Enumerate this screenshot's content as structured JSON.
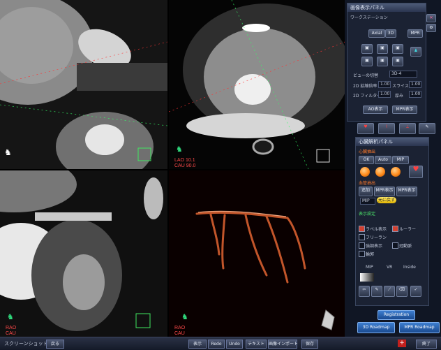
{
  "views": {
    "axial": {
      "orient_label": "LAO",
      "orient_value": "10.1",
      "cau_label": "CAU",
      "cau_value": "90.0"
    },
    "bottom_left": {
      "rao_label": "RAO",
      "cau_label": "CAU"
    },
    "vr": {
      "rao_label": "RAO",
      "cau_label": "CAU"
    }
  },
  "panel_top": {
    "title": "画像表示パネル",
    "sub_title": "ワークステーション",
    "tabs": [
      "Axial",
      "3D",
      "MPR"
    ],
    "rows": [
      {
        "label": "ビューの切替",
        "value": "3D-4"
      },
      {
        "label": "2D 拡縮倍率",
        "value": "1.00",
        "label2": "スライス",
        "value2": "1.00"
      },
      {
        "label": "2D フィルター",
        "value": "1.00",
        "label2": "厚み",
        "value2": "1.00"
      }
    ],
    "button_left": "AO表示",
    "button_right": "MPR表示",
    "icon_captions": [
      "",
      "",
      "",
      ""
    ]
  },
  "panel_bottom": {
    "title": "心臓解析パネル",
    "section1": "心臓抽出",
    "tabs": [
      "OK",
      "Auto",
      "MIP"
    ],
    "section2": "血管抽出",
    "row_buttons": [
      "追加",
      "MPR表示",
      "MPR表示"
    ],
    "select_value": "MIP",
    "yellow_button": "元に戻す",
    "section3": "表示設定",
    "options": [
      {
        "label": "ラベル表示",
        "on": true
      },
      {
        "label": "ルーラー",
        "on": true
      },
      {
        "label": "フリーラン",
        "on": false
      },
      {
        "label": "強調表示",
        "on": false
      },
      {
        "label": "冠動脈",
        "on": false
      },
      {
        "label": "輪郭",
        "on": false
      }
    ],
    "swatch_labels": [
      "MIP",
      "VR",
      "Inside"
    ]
  },
  "action_buttons": {
    "registration": "Registration",
    "roadmap3d": "3D Roadmap",
    "mpr_roadmap": "MPR Roadmap"
  },
  "statusbar": {
    "left": "スクリーンショット",
    "items": [
      "戻る",
      "表示",
      "Redo",
      "Undo",
      "テキスト",
      "画像インポート",
      "保存",
      "終了"
    ]
  },
  "colors": {
    "accent_red": "#ff3b3b",
    "panel_bg": "#1b2233",
    "vessel": "#c2552a",
    "roadmap_blue": "#2a63b8"
  }
}
